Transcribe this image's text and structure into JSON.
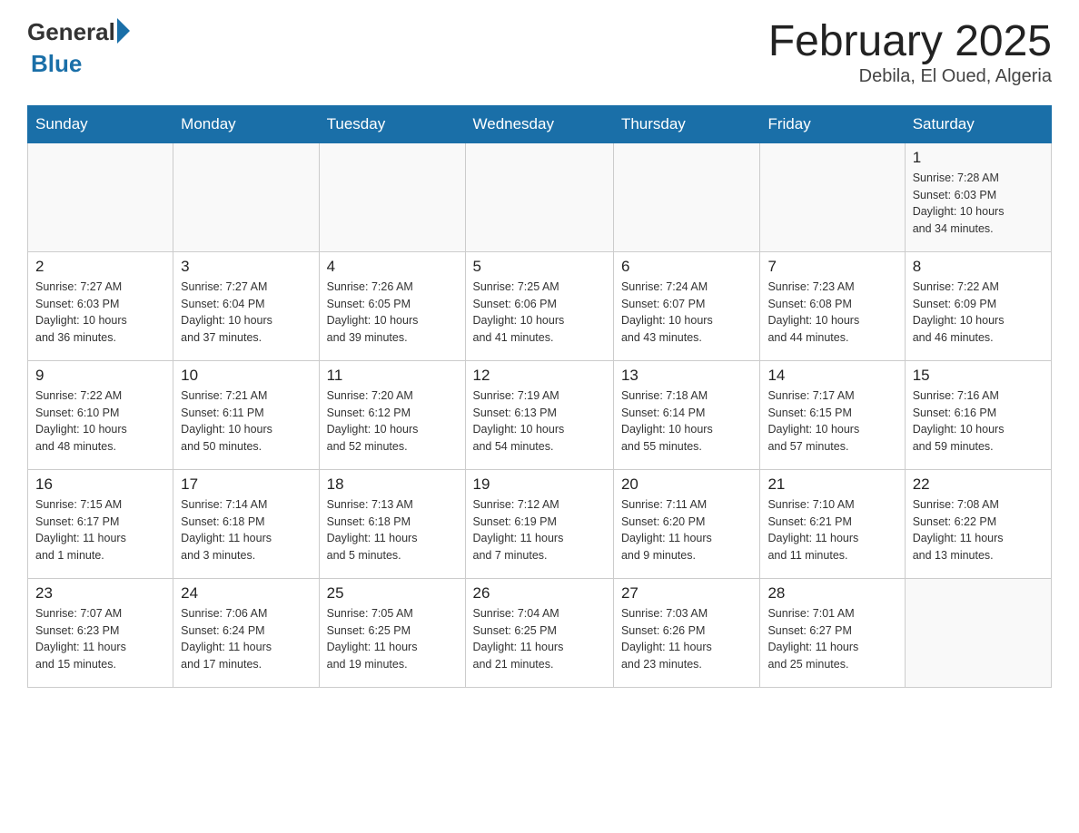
{
  "header": {
    "logo_general": "General",
    "logo_blue": "Blue",
    "title": "February 2025",
    "subtitle": "Debila, El Oued, Algeria"
  },
  "days_of_week": [
    "Sunday",
    "Monday",
    "Tuesday",
    "Wednesday",
    "Thursday",
    "Friday",
    "Saturday"
  ],
  "weeks": [
    [
      {
        "day": "",
        "info": ""
      },
      {
        "day": "",
        "info": ""
      },
      {
        "day": "",
        "info": ""
      },
      {
        "day": "",
        "info": ""
      },
      {
        "day": "",
        "info": ""
      },
      {
        "day": "",
        "info": ""
      },
      {
        "day": "1",
        "info": "Sunrise: 7:28 AM\nSunset: 6:03 PM\nDaylight: 10 hours\nand 34 minutes."
      }
    ],
    [
      {
        "day": "2",
        "info": "Sunrise: 7:27 AM\nSunset: 6:03 PM\nDaylight: 10 hours\nand 36 minutes."
      },
      {
        "day": "3",
        "info": "Sunrise: 7:27 AM\nSunset: 6:04 PM\nDaylight: 10 hours\nand 37 minutes."
      },
      {
        "day": "4",
        "info": "Sunrise: 7:26 AM\nSunset: 6:05 PM\nDaylight: 10 hours\nand 39 minutes."
      },
      {
        "day": "5",
        "info": "Sunrise: 7:25 AM\nSunset: 6:06 PM\nDaylight: 10 hours\nand 41 minutes."
      },
      {
        "day": "6",
        "info": "Sunrise: 7:24 AM\nSunset: 6:07 PM\nDaylight: 10 hours\nand 43 minutes."
      },
      {
        "day": "7",
        "info": "Sunrise: 7:23 AM\nSunset: 6:08 PM\nDaylight: 10 hours\nand 44 minutes."
      },
      {
        "day": "8",
        "info": "Sunrise: 7:22 AM\nSunset: 6:09 PM\nDaylight: 10 hours\nand 46 minutes."
      }
    ],
    [
      {
        "day": "9",
        "info": "Sunrise: 7:22 AM\nSunset: 6:10 PM\nDaylight: 10 hours\nand 48 minutes."
      },
      {
        "day": "10",
        "info": "Sunrise: 7:21 AM\nSunset: 6:11 PM\nDaylight: 10 hours\nand 50 minutes."
      },
      {
        "day": "11",
        "info": "Sunrise: 7:20 AM\nSunset: 6:12 PM\nDaylight: 10 hours\nand 52 minutes."
      },
      {
        "day": "12",
        "info": "Sunrise: 7:19 AM\nSunset: 6:13 PM\nDaylight: 10 hours\nand 54 minutes."
      },
      {
        "day": "13",
        "info": "Sunrise: 7:18 AM\nSunset: 6:14 PM\nDaylight: 10 hours\nand 55 minutes."
      },
      {
        "day": "14",
        "info": "Sunrise: 7:17 AM\nSunset: 6:15 PM\nDaylight: 10 hours\nand 57 minutes."
      },
      {
        "day": "15",
        "info": "Sunrise: 7:16 AM\nSunset: 6:16 PM\nDaylight: 10 hours\nand 59 minutes."
      }
    ],
    [
      {
        "day": "16",
        "info": "Sunrise: 7:15 AM\nSunset: 6:17 PM\nDaylight: 11 hours\nand 1 minute."
      },
      {
        "day": "17",
        "info": "Sunrise: 7:14 AM\nSunset: 6:18 PM\nDaylight: 11 hours\nand 3 minutes."
      },
      {
        "day": "18",
        "info": "Sunrise: 7:13 AM\nSunset: 6:18 PM\nDaylight: 11 hours\nand 5 minutes."
      },
      {
        "day": "19",
        "info": "Sunrise: 7:12 AM\nSunset: 6:19 PM\nDaylight: 11 hours\nand 7 minutes."
      },
      {
        "day": "20",
        "info": "Sunrise: 7:11 AM\nSunset: 6:20 PM\nDaylight: 11 hours\nand 9 minutes."
      },
      {
        "day": "21",
        "info": "Sunrise: 7:10 AM\nSunset: 6:21 PM\nDaylight: 11 hours\nand 11 minutes."
      },
      {
        "day": "22",
        "info": "Sunrise: 7:08 AM\nSunset: 6:22 PM\nDaylight: 11 hours\nand 13 minutes."
      }
    ],
    [
      {
        "day": "23",
        "info": "Sunrise: 7:07 AM\nSunset: 6:23 PM\nDaylight: 11 hours\nand 15 minutes."
      },
      {
        "day": "24",
        "info": "Sunrise: 7:06 AM\nSunset: 6:24 PM\nDaylight: 11 hours\nand 17 minutes."
      },
      {
        "day": "25",
        "info": "Sunrise: 7:05 AM\nSunset: 6:25 PM\nDaylight: 11 hours\nand 19 minutes."
      },
      {
        "day": "26",
        "info": "Sunrise: 7:04 AM\nSunset: 6:25 PM\nDaylight: 11 hours\nand 21 minutes."
      },
      {
        "day": "27",
        "info": "Sunrise: 7:03 AM\nSunset: 6:26 PM\nDaylight: 11 hours\nand 23 minutes."
      },
      {
        "day": "28",
        "info": "Sunrise: 7:01 AM\nSunset: 6:27 PM\nDaylight: 11 hours\nand 25 minutes."
      },
      {
        "day": "",
        "info": ""
      }
    ]
  ]
}
